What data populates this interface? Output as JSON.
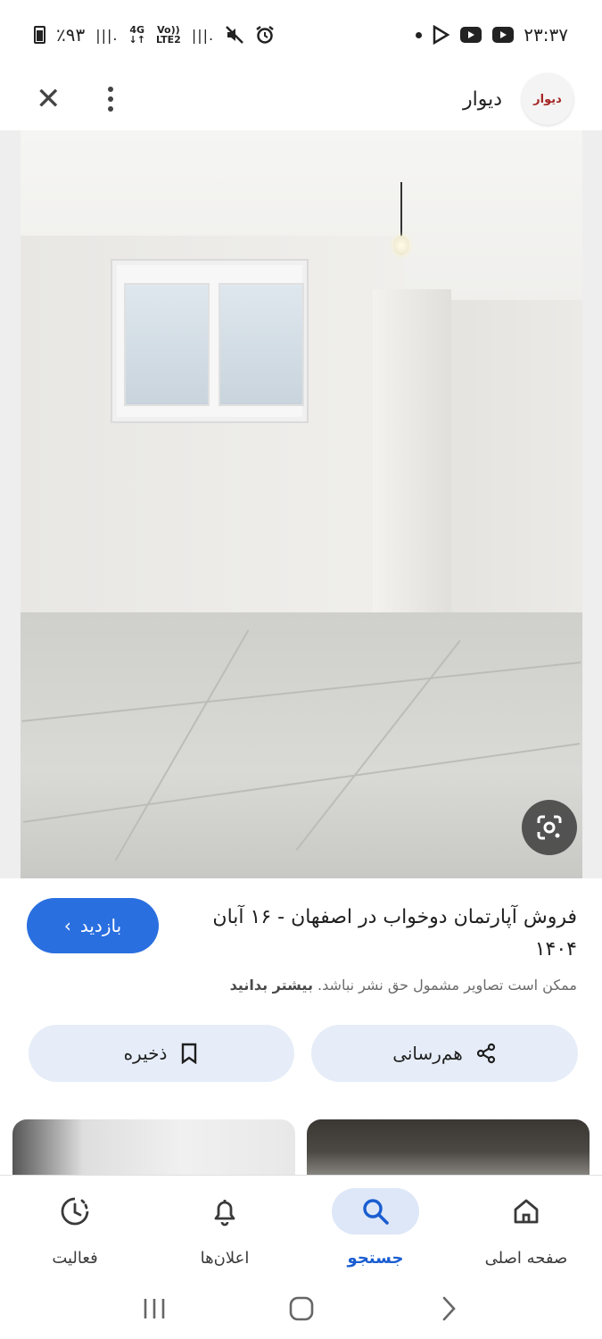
{
  "status_bar": {
    "time": "۲۳:۳۷",
    "battery": "٪۹۳",
    "network_top": "4G",
    "network_volte": "Vo))",
    "network_lte": "LTE2"
  },
  "header": {
    "site_name": "دیوار",
    "logo_text": "دیوار"
  },
  "listing": {
    "title": "فروش آپارتمان دوخواب در اصفهان - ۱۶ آبان ۱۴۰۴",
    "visit_label": "بازدید",
    "notice_text": "ممکن است تصاویر مشمول حق نشر نباشد.",
    "notice_link": "بیشتر بدانید"
  },
  "actions": {
    "share_label": "هم‌رسانی",
    "save_label": "ذخیره"
  },
  "bottom_nav": {
    "home": "صفحه اصلی",
    "search": "جستجو",
    "alerts": "اعلان‌ها",
    "activity": "فعالیت"
  },
  "colors": {
    "accent": "#2a6fe0",
    "pill_bg": "#e6edf8",
    "active_nav": "#1a5dd0"
  },
  "icons": [
    "close-icon",
    "more-vert-icon",
    "google-lens-icon",
    "share-icon",
    "bookmark-icon",
    "home-icon",
    "search-icon",
    "bell-icon",
    "activity-icon",
    "recents-icon",
    "home-circle-icon",
    "back-icon"
  ]
}
